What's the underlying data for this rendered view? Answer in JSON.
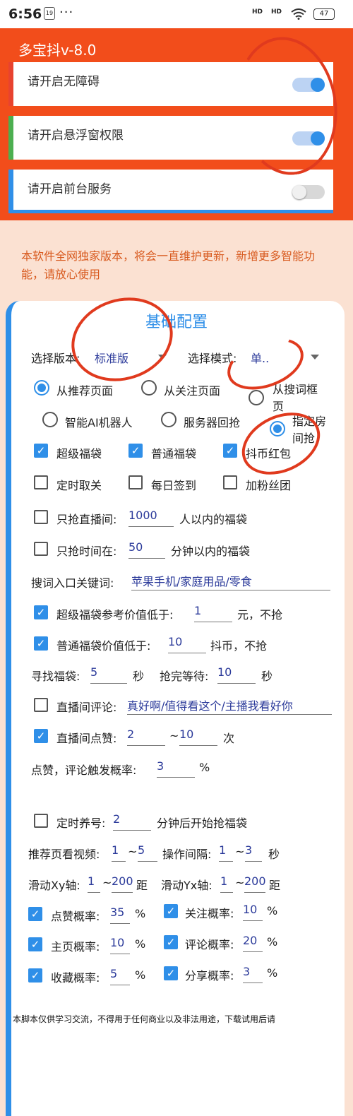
{
  "status_bar": {
    "time": "6:56",
    "notification_badge": "19",
    "more": "···",
    "signal1": "HD",
    "signal2": "HD",
    "wifi_icon": "wifi-icon",
    "battery": "47"
  },
  "app_title": "多宝抖v-8.0",
  "permissions": [
    {
      "label": "请开启无障碍",
      "enabled": true,
      "accent": "#e8432f"
    },
    {
      "label": "请开启悬浮窗权限",
      "enabled": true,
      "accent": "#4caf50"
    },
    {
      "label": "请开启前台服务",
      "enabled": false,
      "accent": "#2f8fe8"
    }
  ],
  "notice": "本软件全网独家版本，将会一直维护更新，新增更多智能功能，请放心使用",
  "section_title": "基础配置",
  "version": {
    "label": "选择版本:",
    "value": "标准版"
  },
  "mode": {
    "label": "选择模式:",
    "value": "单.."
  },
  "sources": [
    {
      "label": "从推荐页面",
      "selected": true
    },
    {
      "label": "从关注页面",
      "selected": false
    },
    {
      "label": "从搜词框页",
      "selected": false
    },
    {
      "label": "智能AI机器人",
      "selected": false
    },
    {
      "label": "服务器回抢",
      "selected": false
    },
    {
      "label": "指定房间抢",
      "selected": true
    }
  ],
  "bag_types": [
    {
      "label": "超级福袋",
      "checked": true
    },
    {
      "label": "普通福袋",
      "checked": true
    },
    {
      "label": "抖币红包",
      "checked": true
    }
  ],
  "options": [
    {
      "label": "定时取关",
      "checked": false
    },
    {
      "label": "每日签到",
      "checked": false
    },
    {
      "label": "加粉丝团",
      "checked": false
    }
  ],
  "live_limit": {
    "checked": false,
    "prefix": "只抢直播间:",
    "value": "1000",
    "suffix": "人以内的福袋"
  },
  "time_limit": {
    "checked": false,
    "prefix": "只抢时间在:",
    "value": "50",
    "suffix": "分钟以内的福袋"
  },
  "keywords": {
    "label": "搜词入口关键词:",
    "value": "苹果手机/家庭用品/零食"
  },
  "super_ref": {
    "checked": true,
    "prefix": "超级福袋参考价值低于:",
    "value": "1",
    "suffix": "元，不抢"
  },
  "normal_ref": {
    "checked": true,
    "prefix": "普通福袋价值低于:",
    "value": "10",
    "suffix": "抖币，不抢"
  },
  "find_bag": {
    "label": "寻找福袋:",
    "value": "5",
    "unit": "秒"
  },
  "wait_after": {
    "label": "抢完等待:",
    "value": "10",
    "unit": "秒"
  },
  "comment": {
    "checked": false,
    "label": "直播间评论:",
    "value": "真好啊/值得看这个/主播我看好你"
  },
  "like": {
    "checked": true,
    "label": "直播间点赞:",
    "min": "2",
    "sep": "~",
    "max": "10",
    "unit": "次"
  },
  "trigger": {
    "label": "点赞，评论触发概率:",
    "value": "3",
    "unit": "%"
  },
  "nurture": {
    "checked": false,
    "label": "定时养号:",
    "value": "2",
    "suffix": "分钟后开始抢福袋"
  },
  "watch_video": {
    "label": "推荐页看视频:",
    "min": "1",
    "sep": "~",
    "max": "5"
  },
  "op_interval": {
    "label": "操作间隔:",
    "min": "1",
    "sep": "~",
    "max": "3",
    "unit": "秒"
  },
  "swipe_xy": {
    "label": "滑动Xy轴:",
    "min": "1",
    "sep": "~",
    "max": "200",
    "unit": "距"
  },
  "swipe_yx": {
    "label": "滑动Yx轴:",
    "min": "1",
    "sep": "~",
    "max": "200",
    "unit": "距"
  },
  "probs": [
    {
      "label": "点赞概率:",
      "value": "35",
      "unit": "%",
      "checked": true
    },
    {
      "label": "关注概率:",
      "value": "10",
      "unit": "%",
      "checked": true
    },
    {
      "label": "主页概率:",
      "value": "10",
      "unit": "%",
      "checked": true
    },
    {
      "label": "评论概率:",
      "value": "20",
      "unit": "%",
      "checked": true
    },
    {
      "label": "收藏概率:",
      "value": "5",
      "unit": "%",
      "checked": true
    },
    {
      "label": "分享概率:",
      "value": "3",
      "unit": "%",
      "checked": true
    }
  ],
  "footer": "本脚本仅供学习交流，不得用于任何商业以及非法用途，下载试用后请"
}
